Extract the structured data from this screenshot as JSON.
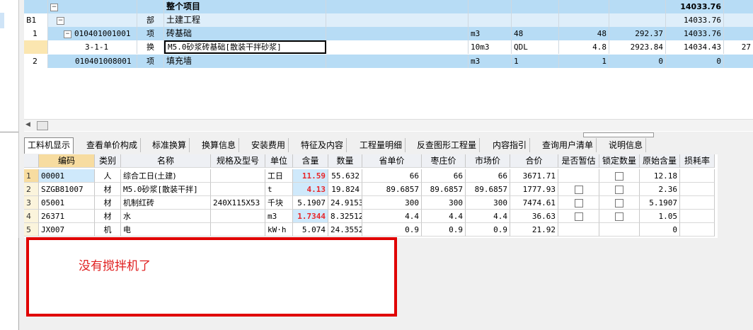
{
  "upper_grid": {
    "rows": [
      {
        "num": "",
        "code": "",
        "type": "",
        "name": "整个项目",
        "unit": "",
        "qty_expr": "",
        "qty": "",
        "price": "",
        "total": "14033.76"
      },
      {
        "num": "B1",
        "code": "",
        "type": "部",
        "name": "土建工程",
        "unit": "",
        "qty_expr": "",
        "qty": "",
        "price": "",
        "total": "14033.76"
      },
      {
        "num": "1",
        "code": "010401001001",
        "type": "项",
        "name": "砖基础",
        "unit": "m3",
        "qty_expr": "48",
        "qty": "48",
        "price": "292.37",
        "total": "14033.76"
      },
      {
        "num": "",
        "code": "3-1-1",
        "type": "换",
        "name": "M5.0砂浆砖基础[散装干拌砂浆]",
        "unit": "10m3",
        "qty_expr": "QDL",
        "qty": "4.8",
        "price": "2923.84",
        "total": "14034.43",
        "extra": "27"
      },
      {
        "num": "2",
        "code": "010401008001",
        "type": "项",
        "name": "填充墙",
        "unit": "m3",
        "qty_expr": "1",
        "qty": "1",
        "price": "0",
        "total": "0"
      }
    ]
  },
  "tabs": [
    "工料机显示",
    "查看单价构成",
    "标准换算",
    "换算信息",
    "安装费用",
    "特征及内容",
    "工程量明细",
    "反查图形工程量",
    "内容指引",
    "查询用户清单",
    "说明信息"
  ],
  "lower_grid": {
    "headers": [
      "编码",
      "类别",
      "名称",
      "规格及型号",
      "单位",
      "含量",
      "数量",
      "省单价",
      "枣庄价",
      "市场价",
      "合价",
      "是否暂估",
      "锁定数量",
      "原始含量",
      "损耗率"
    ],
    "rows": [
      {
        "num": "1",
        "code": "00001",
        "cat": "人",
        "name": "综合工日(土建)",
        "spec": "",
        "unit": "工日",
        "content": "11.59",
        "qty": "55.632",
        "prov_price": "66",
        "zz_price": "66",
        "mkt_price": "66",
        "total": "3671.71",
        "est": false,
        "lock": true,
        "orig": "12.18"
      },
      {
        "num": "2",
        "code": "SZGB81007",
        "cat": "材",
        "name": "M5.0砂浆[散装干拌]",
        "spec": "",
        "unit": "t",
        "content": "4.13",
        "qty": "19.824",
        "prov_price": "89.6857",
        "zz_price": "89.6857",
        "mkt_price": "89.6857",
        "total": "1777.93",
        "est": true,
        "lock": true,
        "orig": "2.36"
      },
      {
        "num": "3",
        "code": "05001",
        "cat": "材",
        "name": "机制红砖",
        "spec": "240X115X53",
        "unit": "千块",
        "content": "5.1907",
        "qty": "24.9153",
        "prov_price": "300",
        "zz_price": "300",
        "mkt_price": "300",
        "total": "7474.61",
        "est": true,
        "lock": true,
        "orig": "5.1907"
      },
      {
        "num": "4",
        "code": "26371",
        "cat": "材",
        "name": "水",
        "spec": "",
        "unit": "m3",
        "content": "1.7344",
        "qty": "8.32512",
        "prov_price": "4.4",
        "zz_price": "4.4",
        "mkt_price": "4.4",
        "total": "36.63",
        "est": true,
        "lock": true,
        "orig": "1.05"
      },
      {
        "num": "5",
        "code": "JX007",
        "cat": "机",
        "name": "电",
        "spec": "",
        "unit": "kW·h",
        "content": "5.074",
        "qty": "24.3552",
        "prov_price": "0.9",
        "zz_price": "0.9",
        "mkt_price": "0.9",
        "total": "21.92",
        "est": false,
        "lock": false,
        "orig": "0"
      }
    ]
  },
  "annotation": {
    "text": "没有搅拌机了",
    "color": "#e00000"
  }
}
